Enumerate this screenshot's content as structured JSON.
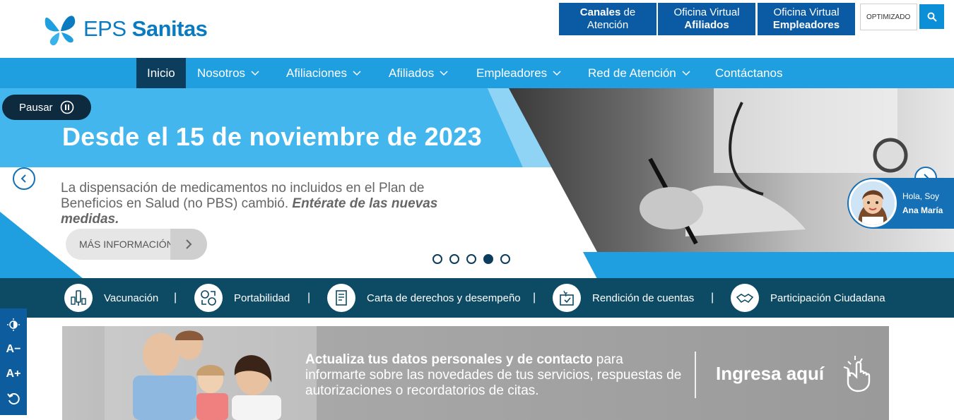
{
  "brand": {
    "name_light": "EPS",
    "name_bold": "Sanitas"
  },
  "top_buttons": [
    {
      "line1_bold": "Canales",
      "line1_rest": " de",
      "line2": "Atención"
    },
    {
      "line1": "Oficina Virtual",
      "line2_bold": "Afiliados"
    },
    {
      "line1": "Oficina Virtual",
      "line2_bold": "Empleadores"
    }
  ],
  "search": {
    "value": "OPTIMIZADO"
  },
  "nav": {
    "items": [
      {
        "label": "Inicio"
      },
      {
        "label": "Nosotros"
      },
      {
        "label": "Afiliaciones"
      },
      {
        "label": "Afiliados"
      },
      {
        "label": "Empleadores"
      },
      {
        "label": "Red de Atención"
      },
      {
        "label": "Contáctanos"
      }
    ]
  },
  "hero": {
    "pause_label": "Pausar",
    "title": "Desde el 15 de noviembre de 2023",
    "body": "La dispensación de medicamentos no incluidos en el Plan de Beneficios en Salud (no PBS) cambió. ",
    "body_emphasis": "Entérate de las nuevas medidas.",
    "cta_label": "MÁS INFORMACIÓN",
    "active_slide": 4,
    "slide_count": 5
  },
  "chat": {
    "greeting": "Hola, Soy",
    "name": "Ana María"
  },
  "shortcuts": [
    {
      "label": "Vacunación",
      "icon": "vaccine-icon"
    },
    {
      "label": "Portabilidad",
      "icon": "portability-icon"
    },
    {
      "label": "Carta de derechos y desempeño",
      "icon": "document-icon"
    },
    {
      "label": "Rendición de cuentas",
      "icon": "accountability-icon"
    },
    {
      "label": "Participación Ciudadana",
      "icon": "handshake-icon"
    }
  ],
  "shortcut_separator": "|",
  "accessibility": {
    "decrease": "A−",
    "increase": "A+"
  },
  "banner": {
    "text_bold": "Actualiza tus datos personales y de contacto",
    "text_rest": " para informarte sobre las novedades de tus servicios, respuestas de autorizaciones o recordatorios de citas.",
    "cta": "Ingresa aquí"
  },
  "colors": {
    "brand_blue": "#0b7bc1",
    "nav_blue": "#1f9ee0",
    "dark_navy": "#0d3d5c",
    "teal_bar": "#0d4a63",
    "top_button": "#0a5ba3"
  }
}
